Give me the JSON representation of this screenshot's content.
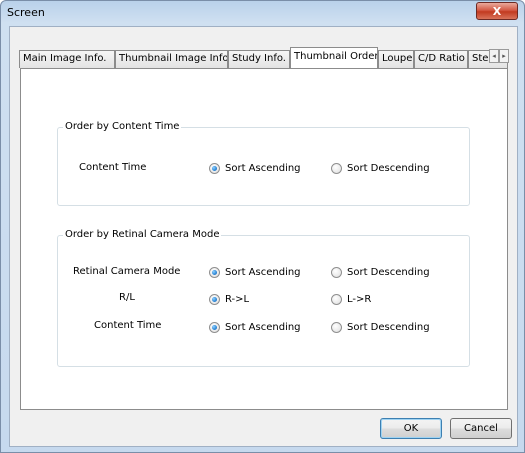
{
  "window": {
    "title": "Screen",
    "close_label": "X"
  },
  "tabs": [
    {
      "label": "Main Image Info."
    },
    {
      "label": "Thumbnail Image Info."
    },
    {
      "label": "Study Info."
    },
    {
      "label": "Thumbnail Order",
      "active": true
    },
    {
      "label": "Loupe"
    },
    {
      "label": "C/D Ratio"
    },
    {
      "label": "Stere"
    }
  ],
  "tab_scroll": {
    "left": "◂",
    "right": "▸"
  },
  "groups": {
    "content_time": {
      "title": "Order by Content Time",
      "rows": [
        {
          "label": "Content Time",
          "options": [
            "Sort Ascending",
            "Sort Descending"
          ],
          "selected": 0
        }
      ]
    },
    "retinal": {
      "title": "Order by Retinal Camera Mode",
      "rows": [
        {
          "label": "Retinal Camera Mode",
          "options": [
            "Sort Ascending",
            "Sort Descending"
          ],
          "selected": 0
        },
        {
          "label": "R/L",
          "options": [
            "R->L",
            "L->R"
          ],
          "selected": 0
        },
        {
          "label": "Content Time",
          "options": [
            "Sort Ascending",
            "Sort Descending"
          ],
          "selected": 0
        }
      ]
    }
  },
  "buttons": {
    "ok": "OK",
    "cancel": "Cancel"
  }
}
